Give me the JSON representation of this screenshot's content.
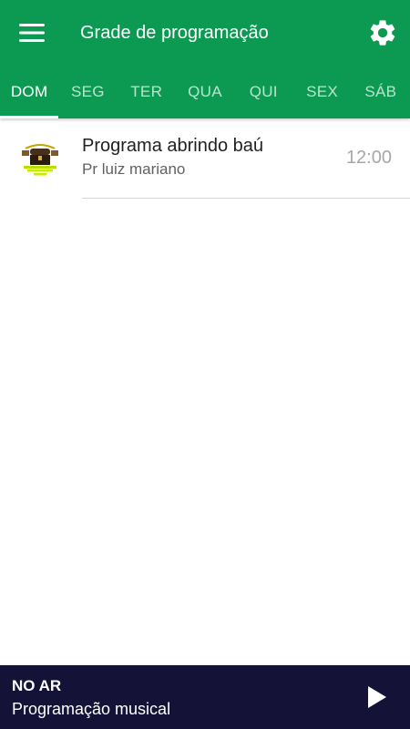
{
  "header": {
    "title": "Grade de programação",
    "menu_icon": "hamburger-menu-icon",
    "settings_icon": "gear-icon",
    "background_color": "#0c9a52"
  },
  "tabs": [
    {
      "label": "DOM",
      "active": true
    },
    {
      "label": "SEG",
      "active": false
    },
    {
      "label": "TER",
      "active": false
    },
    {
      "label": "QUA",
      "active": false
    },
    {
      "label": "QUI",
      "active": false
    },
    {
      "label": "SEX",
      "active": false
    },
    {
      "label": "SÁB",
      "active": false
    }
  ],
  "programs": [
    {
      "name": "Programa abrindo baú",
      "host": "Pr luiz mariano",
      "time": "12:00",
      "thumbnail_icon": "treasure-chest-logo"
    }
  ],
  "player": {
    "status_label": "NO AR",
    "now_playing": "Programação musical",
    "play_icon": "play-icon",
    "background_color": "#151238"
  }
}
